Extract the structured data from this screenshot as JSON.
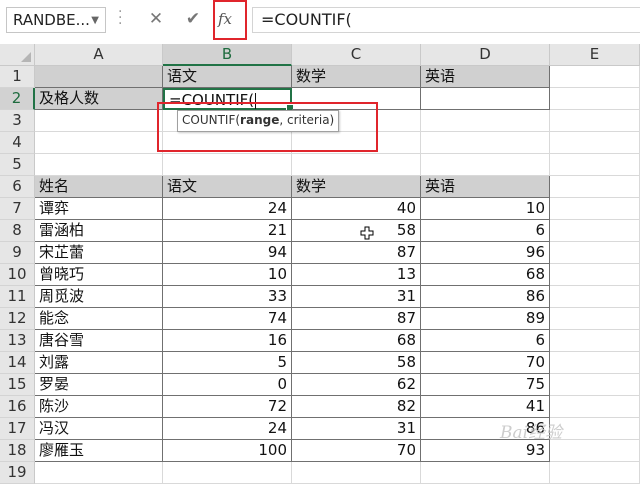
{
  "formula_bar": {
    "name_box": "RANDBE...",
    "formula": "=COUNTIF(",
    "cancel_symbol": "✕",
    "enter_symbol": "✔",
    "fx_symbol": "fx"
  },
  "columns": [
    "A",
    "B",
    "C",
    "D",
    "E"
  ],
  "rows": [
    "1",
    "2",
    "3",
    "4",
    "5",
    "6",
    "7",
    "8",
    "9",
    "10",
    "11",
    "12",
    "13",
    "14",
    "15",
    "16",
    "17",
    "18",
    "19"
  ],
  "top_table": {
    "headers": [
      "语文",
      "数学",
      "英语"
    ],
    "label": "及格人数",
    "edit_text": "=COUNTIF("
  },
  "tooltip": {
    "func": "COUNTIF(",
    "bold_arg": "range",
    "rest": ", criteria)"
  },
  "table": {
    "headers": [
      "姓名",
      "语文",
      "数学",
      "英语"
    ],
    "rows": [
      [
        "谭弈",
        24,
        40,
        10
      ],
      [
        "雷涵柏",
        21,
        58,
        6
      ],
      [
        "宋芷蕾",
        94,
        87,
        96
      ],
      [
        "曾晓巧",
        10,
        13,
        68
      ],
      [
        "周觅波",
        33,
        31,
        86
      ],
      [
        "能念",
        74,
        87,
        89
      ],
      [
        "唐谷雪",
        16,
        68,
        6
      ],
      [
        "刘露",
        5,
        58,
        70
      ],
      [
        "罗晏",
        0,
        62,
        75
      ],
      [
        "陈沙",
        72,
        82,
        41
      ],
      [
        "冯汉",
        24,
        31,
        86
      ],
      [
        "廖雁玉",
        100,
        70,
        93
      ]
    ]
  },
  "watermark": "Bai经验",
  "colors": {
    "accent": "#217346",
    "highlight_box": "#e0252c",
    "header_fill": "#d0d0d0"
  }
}
